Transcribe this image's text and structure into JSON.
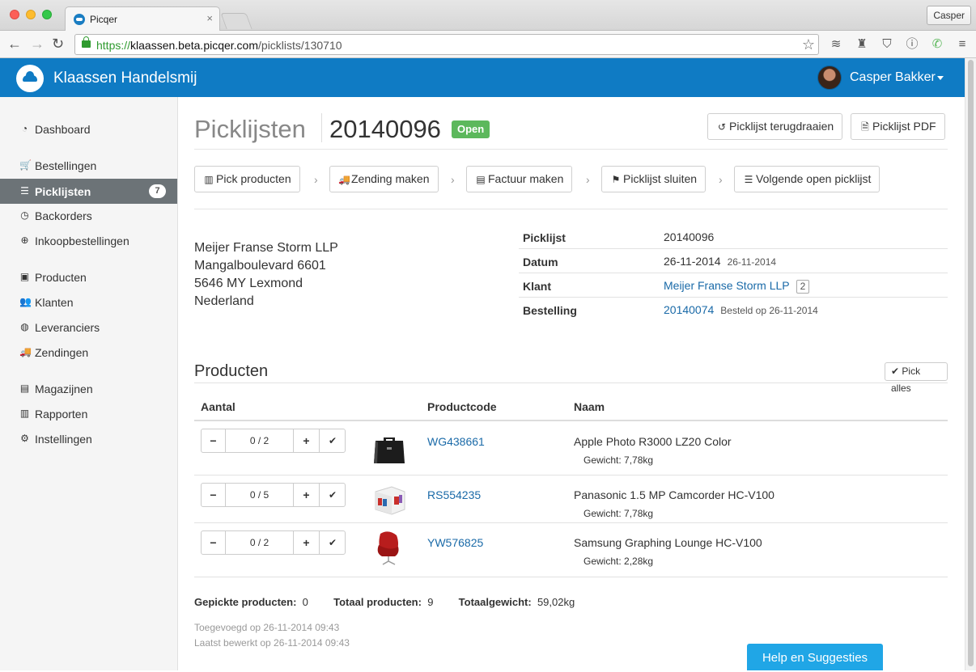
{
  "browser": {
    "tab_title": "Picqer",
    "tab_close": "×",
    "profile_label": "Casper",
    "url_scheme": "https://",
    "url_host": "klaassen.beta.picqer.com",
    "url_path": "/picklists/130710",
    "back": "←",
    "forward": "→",
    "reload": "↻",
    "bookmark": "☆"
  },
  "header": {
    "brand": "Klaassen Handelsmij",
    "user": "Casper Bakker",
    "accent": "#0f7bc4"
  },
  "sidebar": {
    "items": [
      {
        "label": "Dashboard",
        "icon": "dashboard-icon",
        "glyph": "◔"
      },
      {
        "label": "Bestellingen",
        "icon": "cart-icon",
        "glyph": "🛒"
      },
      {
        "label": "Picklijsten",
        "icon": "list-icon",
        "glyph": "☰",
        "badge": "7"
      },
      {
        "label": "Backorders",
        "icon": "clock-icon",
        "glyph": "◷"
      },
      {
        "label": "Inkoopbestellingen",
        "icon": "download-icon",
        "glyph": "⊕"
      },
      {
        "label": "Producten",
        "icon": "picture-icon",
        "glyph": "▣"
      },
      {
        "label": "Klanten",
        "icon": "users-icon",
        "glyph": "👥"
      },
      {
        "label": "Leveranciers",
        "icon": "globe-icon",
        "glyph": "◍"
      },
      {
        "label": "Zendingen",
        "icon": "truck-icon",
        "glyph": "🚚"
      },
      {
        "label": "Magazijnen",
        "icon": "building-icon",
        "glyph": "▤"
      },
      {
        "label": "Rapporten",
        "icon": "bar-chart-icon",
        "glyph": "▥"
      },
      {
        "label": "Instellingen",
        "icon": "gear-icon",
        "glyph": "⚙"
      }
    ]
  },
  "page": {
    "section": "Picklijsten",
    "number": "20140096",
    "status": "Open",
    "status_color": "#5cb85c",
    "actions": {
      "revert": "Picklijst terugdraaien",
      "pdf": "Picklijst PDF"
    },
    "steps": [
      {
        "label": "Pick producten",
        "icon": "barcode-icon",
        "glyph": "▥"
      },
      {
        "label": "Zending maken",
        "icon": "truck-icon",
        "glyph": "🚚"
      },
      {
        "label": "Factuur maken",
        "icon": "invoice-icon",
        "glyph": "▤"
      },
      {
        "label": "Picklijst sluiten",
        "icon": "flag-icon",
        "glyph": "⚑"
      },
      {
        "label": "Volgende open picklijst",
        "icon": "list-icon",
        "glyph": "☰"
      }
    ],
    "step_separator": "›"
  },
  "address": {
    "lines": [
      "Meijer Franse Storm LLP",
      "Mangalboulevard 6601",
      "5646 MY Lexmond",
      "Nederland"
    ]
  },
  "info": {
    "picklijst_label": "Picklijst",
    "picklijst_value": "20140096",
    "datum_label": "Datum",
    "datum_value": "26-11-2014",
    "datum_sub": "26-11-2014",
    "klant_label": "Klant",
    "klant_value": "Meijer Franse Storm LLP",
    "klant_count": "2",
    "bestelling_label": "Bestelling",
    "bestelling_value": "20140074",
    "bestelling_sub": "Besteld op 26-11-2014"
  },
  "products": {
    "title": "Producten",
    "pick_all": "Pick alles",
    "columns": {
      "qty": "Aantal",
      "code": "Productcode",
      "name": "Naam"
    },
    "minus": "−",
    "plus": "+",
    "rows": [
      {
        "qty": "0 / 2",
        "code": "WG438661",
        "name": "Apple Photo R3000 LZ20 Color",
        "weight": "Gewicht: 7,78kg",
        "image": "briefcase"
      },
      {
        "qty": "0 / 5",
        "code": "RS554235",
        "name": "Panasonic 1.5 MP Camcorder HC-V100",
        "weight": "Gewicht: 7,78kg",
        "image": "box"
      },
      {
        "qty": "0 / 2",
        "code": "YW576825",
        "name": "Samsung Graphing Lounge HC-V100",
        "weight": "Gewicht: 2,28kg",
        "image": "red-chair"
      }
    ]
  },
  "summary": {
    "picked_label": "Gepickte producten:",
    "picked_value": "0",
    "total_label": "Totaal producten:",
    "total_value": "9",
    "weight_label": "Totaalgewicht:",
    "weight_value": "59,02kg",
    "added": "Toegevoegd op 26-11-2014 09:43",
    "edited": "Laatst bewerkt op 26-11-2014 09:43"
  },
  "help": {
    "label": "Help en Suggesties"
  }
}
